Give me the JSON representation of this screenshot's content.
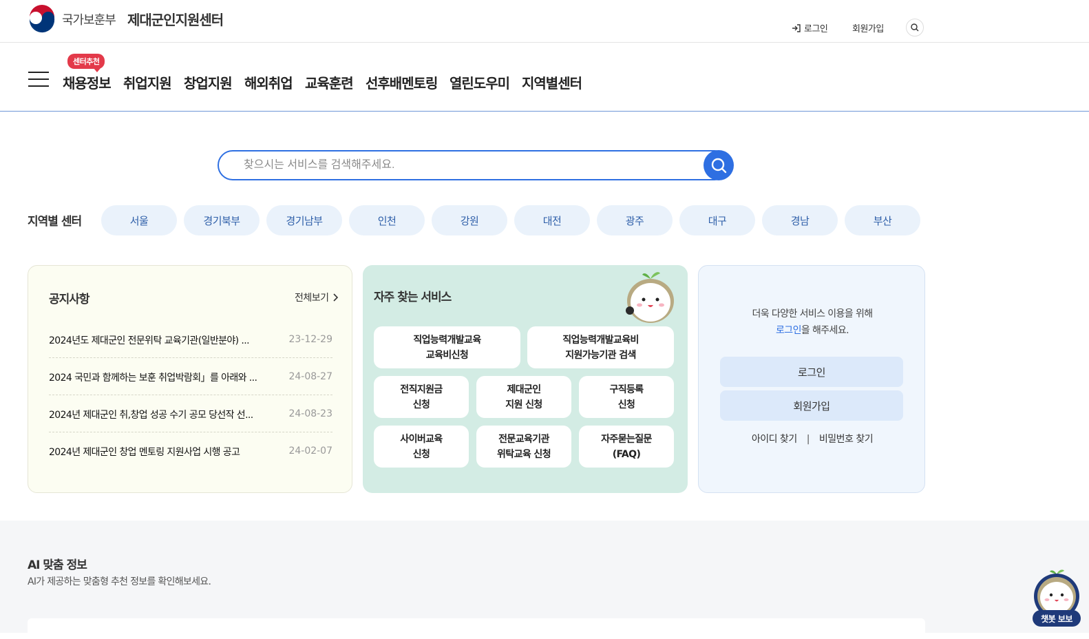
{
  "header": {
    "ministry": "국가보훈부",
    "center_name": "제대군인지원센터",
    "login": "로그인",
    "join": "회원가입"
  },
  "gnb": {
    "badge": "센터추천",
    "items": [
      "채용정보",
      "취업지원",
      "창업지원",
      "해외취업",
      "교육훈련",
      "선후배멘토링",
      "열린도우미",
      "지역별센터"
    ]
  },
  "search": {
    "placeholder": "찾으시는 서비스를 검색해주세요."
  },
  "regions": {
    "title": "지역별 센터",
    "items": [
      "서울",
      "경기북부",
      "경기남부",
      "인천",
      "강원",
      "대전",
      "광주",
      "대구",
      "경남",
      "부산"
    ]
  },
  "notice": {
    "title": "공지사항",
    "more": "전체보기",
    "items": [
      {
        "title": "2024년도 제대군인 전문위탁 교육기관(일반분야) ...",
        "date": "23-12-29"
      },
      {
        "title": "2024 국민과 함께하는 보훈 취업박람회」를 아래와 ...",
        "date": "24-08-27"
      },
      {
        "title": "2024년 제대군인 취,창업 성공 수기 공모 당선작 선...",
        "date": "24-08-23"
      },
      {
        "title": "2024년 제대군인 창업 멘토링 지원사업 시행 공고",
        "date": "24-02-07"
      }
    ]
  },
  "services": {
    "title": "자주 찾는 서비스",
    "items": [
      "직업능력개발교육\n교육비신청",
      "직업능력개발교육비\n지원가능기관 검색",
      "전직지원금\n신청",
      "제대군인\n지원 신청",
      "구직등록\n신청",
      "사이버교육\n신청",
      "전문교육기관\n위탁교육 신청",
      "자주묻는질문\n(FAQ)"
    ]
  },
  "login_box": {
    "msg_line1": "더욱 다양한 서비스 이용을 위해",
    "msg_link": "로그인",
    "msg_rest": "을 해주세요.",
    "login_btn": "로그인",
    "join_btn": "회원가입",
    "find_id": "아이디 찾기",
    "separator": "|",
    "find_pw": "비밀번호 찾기"
  },
  "ai": {
    "title": "AI 맞춤 정보",
    "subtitle": "AI가 제공하는 맞춤형 추천 정보를 확인해보세요."
  },
  "chatbot": {
    "label": "챗봇 보보"
  },
  "colors": {
    "primary": "#2e6fe2",
    "badge": "#e33a4a",
    "region_bg": "#eaf2fb",
    "notice_bg": "#fcfdf2",
    "service_bg": "#d3ece4",
    "login_bg": "#f0f6fd"
  }
}
